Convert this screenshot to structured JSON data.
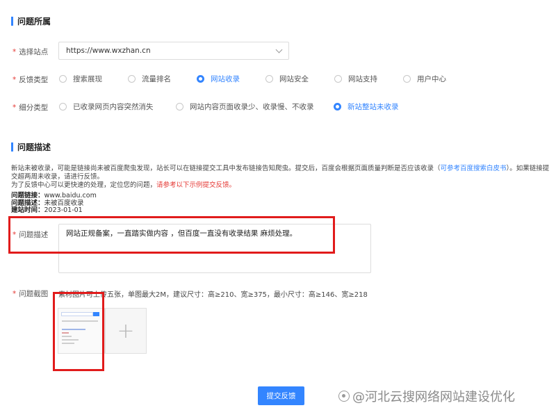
{
  "sections": {
    "belong_title": "问题所属",
    "desc_title": "问题描述"
  },
  "form": {
    "site": {
      "label": "选择站点",
      "value": "https://www.wxzhan.cn"
    },
    "feedback_type": {
      "label": "反馈类型",
      "options": [
        "搜索展现",
        "流量排名",
        "网站收录",
        "网站安全",
        "网站支持",
        "用户中心"
      ],
      "selected": "网站收录"
    },
    "sub_type": {
      "label": "细分类型",
      "options": [
        "已收录网页内容突然消失",
        "网站内容页面收录少、收录慢、不收录",
        "新站整站未收录"
      ],
      "selected": "新站整站未收录"
    }
  },
  "description": {
    "para1_text": "新站未被收录，可能是链接尚未被百度爬虫发现，站长可以在链接提交工具中发布链接告知爬虫。提交后，百度会根据页面质量判断是否应该收录（",
    "para1_link": "可参考百度搜索白皮书",
    "para1_tail": "）。如果链接提交超两周未收录，请进行反馈。",
    "para2_text": "为了反馈中心可以更快速的处理，定位您的问题，",
    "para2_red": "请参考以下示例提交反馈。",
    "example": {
      "link_label": "问题链接：",
      "link_value": "www.baidu.com",
      "desc_label": "问题描述：",
      "desc_value": "未被百度收录",
      "date_label": "建站时间：",
      "date_value": "2023-01-01"
    }
  },
  "problem_desc": {
    "label": "问题描述",
    "value": "网站正规备案，一直踏实做内容 ，但百度一直没有收录结果 麻烦处理。"
  },
  "screenshot": {
    "label": "问题截图",
    "hint": "素材图片可上传五张，单图最大2M，建议尺寸：高≥210、宽≥375，最小尺寸：高≥146、宽≥218",
    "add_symbol": "+"
  },
  "submit_label": "提交反馈",
  "watermark": "@河北云搜网络网站建设优化",
  "required_mark": "*",
  "colors": {
    "accent": "#3385ff",
    "highlight_box": "#e11b1b",
    "required": "#e53935"
  }
}
